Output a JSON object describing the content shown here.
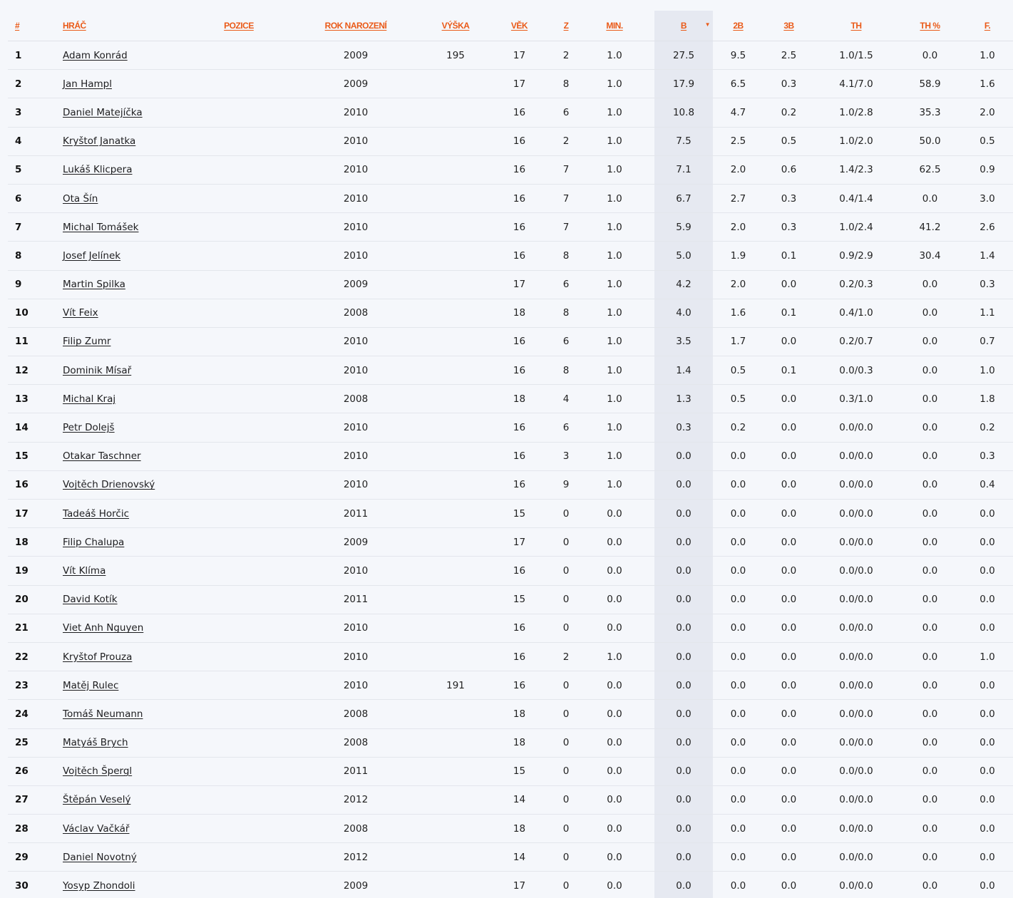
{
  "columns": [
    {
      "key": "num",
      "label": "#"
    },
    {
      "key": "player",
      "label": "HRÁČ"
    },
    {
      "key": "position",
      "label": "POZICE"
    },
    {
      "key": "birth_year",
      "label": "ROK NAROZENÍ"
    },
    {
      "key": "height",
      "label": "VÝŠKA"
    },
    {
      "key": "age",
      "label": "VĚK"
    },
    {
      "key": "games",
      "label": "Z"
    },
    {
      "key": "min",
      "label": "MIN."
    },
    {
      "key": "points",
      "label": "B"
    },
    {
      "key": "two_pt",
      "label": "2B"
    },
    {
      "key": "three_pt",
      "label": "3B"
    },
    {
      "key": "ft",
      "label": "TH"
    },
    {
      "key": "ft_pct",
      "label": "TH %"
    },
    {
      "key": "fouls",
      "label": "F."
    }
  ],
  "sort": {
    "column": "points",
    "direction_icon": "sort-desc-icon"
  },
  "rows": [
    {
      "num": "1",
      "player": "Adam Konrád",
      "position": "",
      "birth_year": "2009",
      "height": "195",
      "age": "17",
      "games": "2",
      "min": "1.0",
      "points": "27.5",
      "two_pt": "9.5",
      "three_pt": "2.5",
      "ft": "1.0/1.5",
      "ft_pct": "0.0",
      "fouls": "1.0"
    },
    {
      "num": "2",
      "player": "Jan Hampl",
      "position": "",
      "birth_year": "2009",
      "height": "",
      "age": "17",
      "games": "8",
      "min": "1.0",
      "points": "17.9",
      "two_pt": "6.5",
      "three_pt": "0.3",
      "ft": "4.1/7.0",
      "ft_pct": "58.9",
      "fouls": "1.6"
    },
    {
      "num": "3",
      "player": "Daniel Matejíčka",
      "position": "",
      "birth_year": "2010",
      "height": "",
      "age": "16",
      "games": "6",
      "min": "1.0",
      "points": "10.8",
      "two_pt": "4.7",
      "three_pt": "0.2",
      "ft": "1.0/2.8",
      "ft_pct": "35.3",
      "fouls": "2.0"
    },
    {
      "num": "4",
      "player": "Kryštof Janatka",
      "position": "",
      "birth_year": "2010",
      "height": "",
      "age": "16",
      "games": "2",
      "min": "1.0",
      "points": "7.5",
      "two_pt": "2.5",
      "three_pt": "0.5",
      "ft": "1.0/2.0",
      "ft_pct": "50.0",
      "fouls": "0.5"
    },
    {
      "num": "5",
      "player": "Lukáš Klicpera",
      "position": "",
      "birth_year": "2010",
      "height": "",
      "age": "16",
      "games": "7",
      "min": "1.0",
      "points": "7.1",
      "two_pt": "2.0",
      "three_pt": "0.6",
      "ft": "1.4/2.3",
      "ft_pct": "62.5",
      "fouls": "0.9"
    },
    {
      "num": "6",
      "player": "Ota Šín",
      "position": "",
      "birth_year": "2010",
      "height": "",
      "age": "16",
      "games": "7",
      "min": "1.0",
      "points": "6.7",
      "two_pt": "2.7",
      "three_pt": "0.3",
      "ft": "0.4/1.4",
      "ft_pct": "0.0",
      "fouls": "3.0"
    },
    {
      "num": "7",
      "player": "Michal Tomášek",
      "position": "",
      "birth_year": "2010",
      "height": "",
      "age": "16",
      "games": "7",
      "min": "1.0",
      "points": "5.9",
      "two_pt": "2.0",
      "three_pt": "0.3",
      "ft": "1.0/2.4",
      "ft_pct": "41.2",
      "fouls": "2.6"
    },
    {
      "num": "8",
      "player": "Josef Jelínek",
      "position": "",
      "birth_year": "2010",
      "height": "",
      "age": "16",
      "games": "8",
      "min": "1.0",
      "points": "5.0",
      "two_pt": "1.9",
      "three_pt": "0.1",
      "ft": "0.9/2.9",
      "ft_pct": "30.4",
      "fouls": "1.4"
    },
    {
      "num": "9",
      "player": "Martin Spilka",
      "position": "",
      "birth_year": "2009",
      "height": "",
      "age": "17",
      "games": "6",
      "min": "1.0",
      "points": "4.2",
      "two_pt": "2.0",
      "three_pt": "0.0",
      "ft": "0.2/0.3",
      "ft_pct": "0.0",
      "fouls": "0.3"
    },
    {
      "num": "10",
      "player": "Vít Feix",
      "position": "",
      "birth_year": "2008",
      "height": "",
      "age": "18",
      "games": "8",
      "min": "1.0",
      "points": "4.0",
      "two_pt": "1.6",
      "three_pt": "0.1",
      "ft": "0.4/1.0",
      "ft_pct": "0.0",
      "fouls": "1.1"
    },
    {
      "num": "11",
      "player": "Filip Zumr",
      "position": "",
      "birth_year": "2010",
      "height": "",
      "age": "16",
      "games": "6",
      "min": "1.0",
      "points": "3.5",
      "two_pt": "1.7",
      "three_pt": "0.0",
      "ft": "0.2/0.7",
      "ft_pct": "0.0",
      "fouls": "0.7"
    },
    {
      "num": "12",
      "player": "Dominik Mísař",
      "position": "",
      "birth_year": "2010",
      "height": "",
      "age": "16",
      "games": "8",
      "min": "1.0",
      "points": "1.4",
      "two_pt": "0.5",
      "three_pt": "0.1",
      "ft": "0.0/0.3",
      "ft_pct": "0.0",
      "fouls": "1.0"
    },
    {
      "num": "13",
      "player": "Michal Kraj",
      "position": "",
      "birth_year": "2008",
      "height": "",
      "age": "18",
      "games": "4",
      "min": "1.0",
      "points": "1.3",
      "two_pt": "0.5",
      "three_pt": "0.0",
      "ft": "0.3/1.0",
      "ft_pct": "0.0",
      "fouls": "1.8"
    },
    {
      "num": "14",
      "player": "Petr Dolejš",
      "position": "",
      "birth_year": "2010",
      "height": "",
      "age": "16",
      "games": "6",
      "min": "1.0",
      "points": "0.3",
      "two_pt": "0.2",
      "three_pt": "0.0",
      "ft": "0.0/0.0",
      "ft_pct": "0.0",
      "fouls": "0.2"
    },
    {
      "num": "15",
      "player": "Otakar Taschner",
      "position": "",
      "birth_year": "2010",
      "height": "",
      "age": "16",
      "games": "3",
      "min": "1.0",
      "points": "0.0",
      "two_pt": "0.0",
      "three_pt": "0.0",
      "ft": "0.0/0.0",
      "ft_pct": "0.0",
      "fouls": "0.3"
    },
    {
      "num": "16",
      "player": "Vojtěch Drienovský",
      "position": "",
      "birth_year": "2010",
      "height": "",
      "age": "16",
      "games": "9",
      "min": "1.0",
      "points": "0.0",
      "two_pt": "0.0",
      "three_pt": "0.0",
      "ft": "0.0/0.0",
      "ft_pct": "0.0",
      "fouls": "0.4"
    },
    {
      "num": "17",
      "player": "Tadeáš Horčic",
      "position": "",
      "birth_year": "2011",
      "height": "",
      "age": "15",
      "games": "0",
      "min": "0.0",
      "points": "0.0",
      "two_pt": "0.0",
      "three_pt": "0.0",
      "ft": "0.0/0.0",
      "ft_pct": "0.0",
      "fouls": "0.0"
    },
    {
      "num": "18",
      "player": "Filip Chalupa",
      "position": "",
      "birth_year": "2009",
      "height": "",
      "age": "17",
      "games": "0",
      "min": "0.0",
      "points": "0.0",
      "two_pt": "0.0",
      "three_pt": "0.0",
      "ft": "0.0/0.0",
      "ft_pct": "0.0",
      "fouls": "0.0"
    },
    {
      "num": "19",
      "player": "Vít Klíma",
      "position": "",
      "birth_year": "2010",
      "height": "",
      "age": "16",
      "games": "0",
      "min": "0.0",
      "points": "0.0",
      "two_pt": "0.0",
      "three_pt": "0.0",
      "ft": "0.0/0.0",
      "ft_pct": "0.0",
      "fouls": "0.0"
    },
    {
      "num": "20",
      "player": "David Kotík",
      "position": "",
      "birth_year": "2011",
      "height": "",
      "age": "15",
      "games": "0",
      "min": "0.0",
      "points": "0.0",
      "two_pt": "0.0",
      "three_pt": "0.0",
      "ft": "0.0/0.0",
      "ft_pct": "0.0",
      "fouls": "0.0"
    },
    {
      "num": "21",
      "player": "Viet Anh Nguyen",
      "position": "",
      "birth_year": "2010",
      "height": "",
      "age": "16",
      "games": "0",
      "min": "0.0",
      "points": "0.0",
      "two_pt": "0.0",
      "three_pt": "0.0",
      "ft": "0.0/0.0",
      "ft_pct": "0.0",
      "fouls": "0.0"
    },
    {
      "num": "22",
      "player": "Kryštof Prouza",
      "position": "",
      "birth_year": "2010",
      "height": "",
      "age": "16",
      "games": "2",
      "min": "1.0",
      "points": "0.0",
      "two_pt": "0.0",
      "three_pt": "0.0",
      "ft": "0.0/0.0",
      "ft_pct": "0.0",
      "fouls": "1.0"
    },
    {
      "num": "23",
      "player": "Matěj Rulec",
      "position": "",
      "birth_year": "2010",
      "height": "191",
      "age": "16",
      "games": "0",
      "min": "0.0",
      "points": "0.0",
      "two_pt": "0.0",
      "three_pt": "0.0",
      "ft": "0.0/0.0",
      "ft_pct": "0.0",
      "fouls": "0.0"
    },
    {
      "num": "24",
      "player": "Tomáš Neumann",
      "position": "",
      "birth_year": "2008",
      "height": "",
      "age": "18",
      "games": "0",
      "min": "0.0",
      "points": "0.0",
      "two_pt": "0.0",
      "three_pt": "0.0",
      "ft": "0.0/0.0",
      "ft_pct": "0.0",
      "fouls": "0.0"
    },
    {
      "num": "25",
      "player": "Matyáš Brych",
      "position": "",
      "birth_year": "2008",
      "height": "",
      "age": "18",
      "games": "0",
      "min": "0.0",
      "points": "0.0",
      "two_pt": "0.0",
      "three_pt": "0.0",
      "ft": "0.0/0.0",
      "ft_pct": "0.0",
      "fouls": "0.0"
    },
    {
      "num": "26",
      "player": "Vojtěch Špergl",
      "position": "",
      "birth_year": "2011",
      "height": "",
      "age": "15",
      "games": "0",
      "min": "0.0",
      "points": "0.0",
      "two_pt": "0.0",
      "three_pt": "0.0",
      "ft": "0.0/0.0",
      "ft_pct": "0.0",
      "fouls": "0.0"
    },
    {
      "num": "27",
      "player": "Štěpán Veselý",
      "position": "",
      "birth_year": "2012",
      "height": "",
      "age": "14",
      "games": "0",
      "min": "0.0",
      "points": "0.0",
      "two_pt": "0.0",
      "three_pt": "0.0",
      "ft": "0.0/0.0",
      "ft_pct": "0.0",
      "fouls": "0.0"
    },
    {
      "num": "28",
      "player": "Václav Vačkář",
      "position": "",
      "birth_year": "2008",
      "height": "",
      "age": "18",
      "games": "0",
      "min": "0.0",
      "points": "0.0",
      "two_pt": "0.0",
      "three_pt": "0.0",
      "ft": "0.0/0.0",
      "ft_pct": "0.0",
      "fouls": "0.0"
    },
    {
      "num": "29",
      "player": "Daniel Novotný",
      "position": "",
      "birth_year": "2012",
      "height": "",
      "age": "14",
      "games": "0",
      "min": "0.0",
      "points": "0.0",
      "two_pt": "0.0",
      "three_pt": "0.0",
      "ft": "0.0/0.0",
      "ft_pct": "0.0",
      "fouls": "0.0"
    },
    {
      "num": "30",
      "player": "Yosyp Zhondoli",
      "position": "",
      "birth_year": "2009",
      "height": "",
      "age": "17",
      "games": "0",
      "min": "0.0",
      "points": "0.0",
      "two_pt": "0.0",
      "three_pt": "0.0",
      "ft": "0.0/0.0",
      "ft_pct": "0.0",
      "fouls": "0.0"
    }
  ],
  "colors": {
    "header_accent": "#ea5a18",
    "sorted_column_bg": "#e6e9f1",
    "page_bg": "#f5f7fb"
  }
}
